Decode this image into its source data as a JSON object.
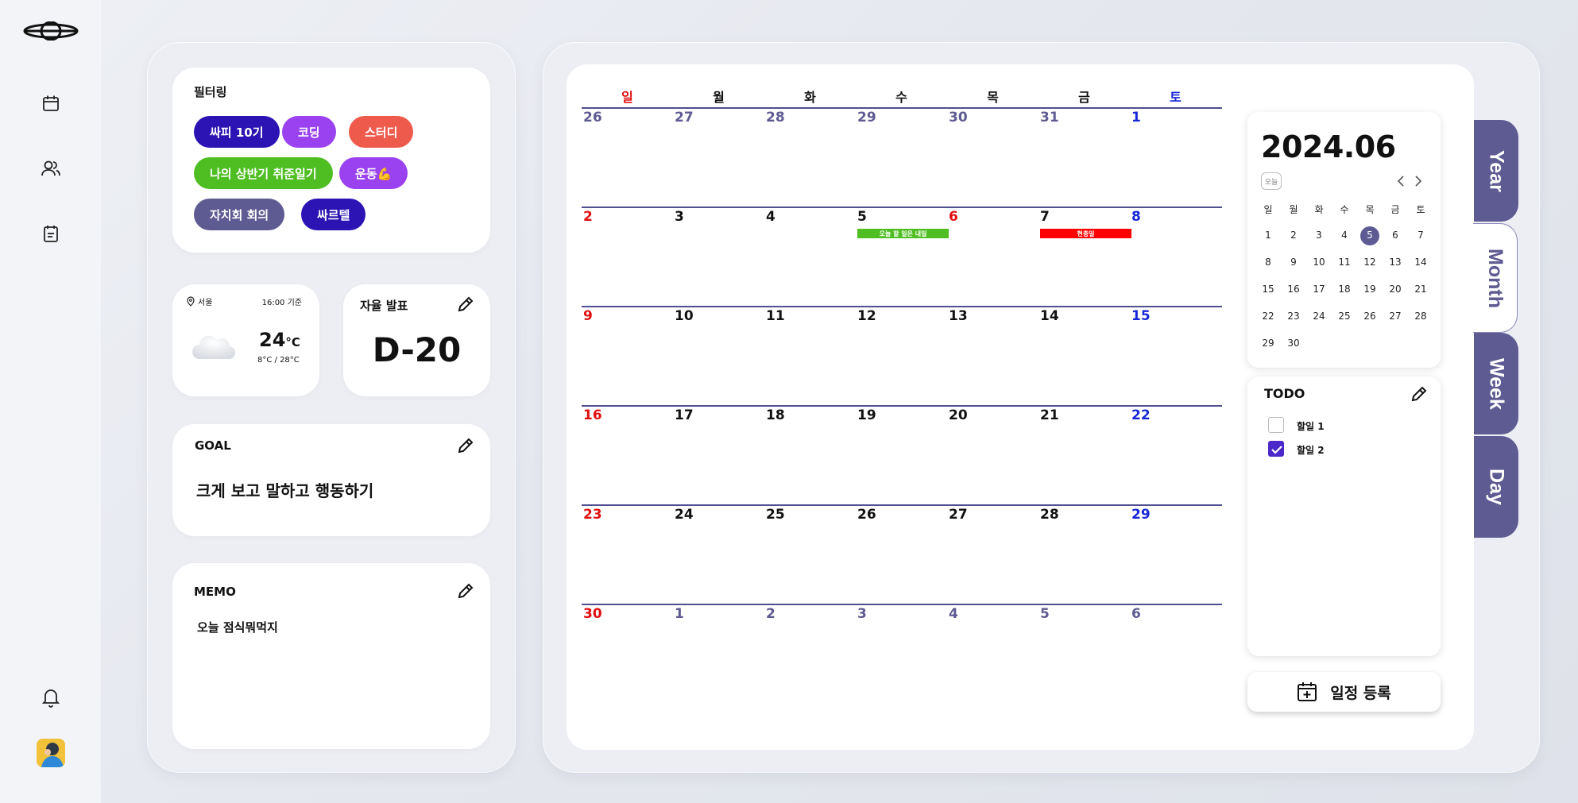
{
  "filter": {
    "title": "필터링",
    "chips": [
      {
        "label": "싸피 10기",
        "color": "#2b14b3"
      },
      {
        "label": "코딩",
        "color": "#9a42f0"
      },
      {
        "label": "스터디",
        "color": "#ee5a4b"
      },
      {
        "label": "나의 상반기 취준일기",
        "color": "#4fbe22"
      },
      {
        "label": "운동💪",
        "color": "#9a42f0"
      },
      {
        "label": "자치회 회의",
        "color": "#5e5a92"
      },
      {
        "label": "싸르텔",
        "color": "#2b14b3"
      }
    ]
  },
  "weather": {
    "location": "서울",
    "time": "16:00 기준",
    "temp": "24",
    "unit": "°C",
    "range": "8°C / 28°C",
    "icon": "cloud-icon"
  },
  "dday": {
    "title": "자율 발표",
    "value": "D-20"
  },
  "goal": {
    "title": "GOAL",
    "text": "크게 보고 말하고 행동하기"
  },
  "memo": {
    "title": "MEMO",
    "text": "오늘 점식뭐먹지"
  },
  "calendar": {
    "weekdays": [
      "일",
      "월",
      "화",
      "수",
      "목",
      "금",
      "토"
    ],
    "weeks": [
      [
        "26",
        "27",
        "28",
        "29",
        "30",
        "31",
        "1"
      ],
      [
        "2",
        "3",
        "4",
        "5",
        "6",
        "7",
        "8"
      ],
      [
        "9",
        "10",
        "11",
        "12",
        "13",
        "14",
        "15"
      ],
      [
        "16",
        "17",
        "18",
        "19",
        "20",
        "21",
        "22"
      ],
      [
        "23",
        "24",
        "25",
        "26",
        "27",
        "28",
        "29"
      ],
      [
        "30",
        "1",
        "2",
        "3",
        "4",
        "5",
        "6"
      ]
    ],
    "events": [
      {
        "label": "오늘 할 일은 내일",
        "color": "#4fbe22"
      },
      {
        "label": "현충일",
        "color": "#ff0000"
      }
    ]
  },
  "mini": {
    "title": "2024.06",
    "today": "오늘",
    "weekdays": [
      "일",
      "월",
      "화",
      "수",
      "목",
      "금",
      "토"
    ],
    "days": [
      [
        "1",
        "2",
        "3",
        "4",
        "5",
        "6",
        "7"
      ],
      [
        "8",
        "9",
        "10",
        "11",
        "12",
        "13",
        "14"
      ],
      [
        "15",
        "16",
        "17",
        "18",
        "19",
        "20",
        "21"
      ],
      [
        "22",
        "23",
        "24",
        "25",
        "26",
        "27",
        "28"
      ],
      [
        "29",
        "30"
      ]
    ],
    "selected": "5"
  },
  "todo": {
    "title": "TODO",
    "items": [
      {
        "label": "할일 1",
        "done": false
      },
      {
        "label": "할일 2",
        "done": true
      }
    ]
  },
  "add_button": {
    "label": "일정 등록"
  },
  "tabs": [
    "Year",
    "Month",
    "Week",
    "Day"
  ],
  "active_tab": "Month",
  "colors": {
    "accent": "#5e5a92",
    "sunday": "#e01010",
    "saturday": "#1726d6",
    "other_month": "#5e5a92"
  }
}
